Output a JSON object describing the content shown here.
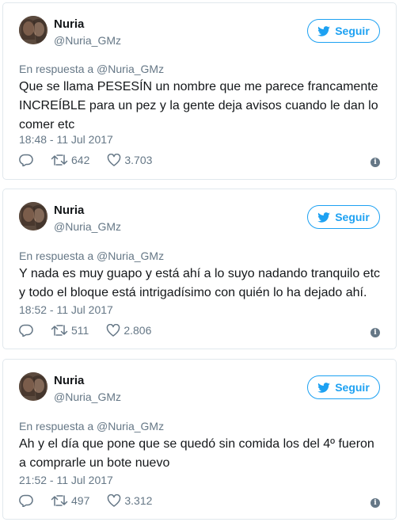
{
  "tweets": [
    {
      "name": "Nuria",
      "handle": "@Nuria_GMz",
      "follow_label": "Seguir",
      "reply_to": "En respuesta a @Nuria_GMz",
      "text": "Que se llama PESESÍN un nombre que me parece francamente INCREÍBLE para un pez y la gente deja avisos cuando le dan lo comer etc",
      "timestamp": "18:48 - 11 Jul 2017",
      "retweets": "642",
      "likes": "3.703"
    },
    {
      "name": "Nuria",
      "handle": "@Nuria_GMz",
      "follow_label": "Seguir",
      "reply_to": "En respuesta a @Nuria_GMz",
      "text": "Y nada es muy guapo y está ahí a lo suyo nadando tranquilo etc y todo el bloque está intrigadísimo con quién lo ha dejado ahí.",
      "timestamp": "18:52 - 11 Jul 2017",
      "retweets": "511",
      "likes": "2.806"
    },
    {
      "name": "Nuria",
      "handle": "@Nuria_GMz",
      "follow_label": "Seguir",
      "reply_to": "En respuesta a @Nuria_GMz",
      "text": "Ah y el día que pone que se quedó sin comida los del 4º fueron a comprarle un bote nuevo",
      "timestamp": "21:52 - 11 Jul 2017",
      "retweets": "497",
      "likes": "3.312"
    }
  ],
  "icons": {
    "follow": "twitter-bird-icon",
    "reply": "reply-icon",
    "retweet": "retweet-icon",
    "like": "heart-icon",
    "info": "info-icon"
  },
  "colors": {
    "accent": "#1da1f2",
    "text": "#14171a",
    "muted": "#657786",
    "border": "#e1e8ed"
  }
}
